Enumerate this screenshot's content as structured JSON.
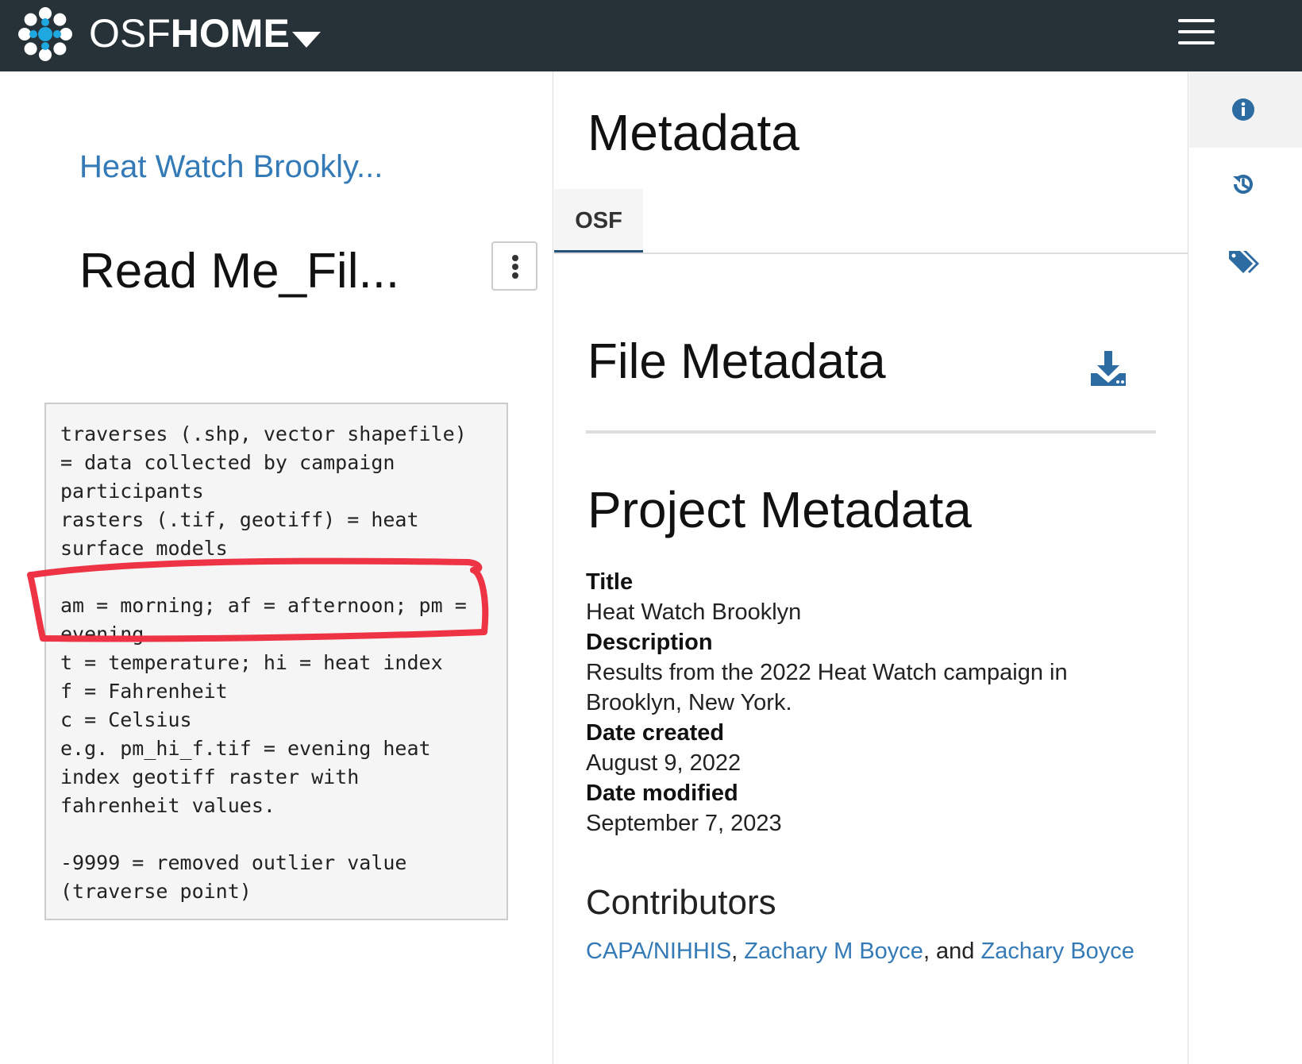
{
  "header": {
    "brand_osf": "OSF",
    "brand_home": "HOME",
    "icons": {
      "logo": "osf-logo-icon",
      "caret": "caret-down-icon",
      "menu": "hamburger-menu-icon"
    },
    "colors": {
      "bar": "#263238",
      "text": "#ffffff"
    }
  },
  "left": {
    "breadcrumb": "Heat Watch Brookly...",
    "file_title": "Read Me_Fil...",
    "kebab_icon": "vertical-ellipsis-icon",
    "readme_text": "traverses (.shp, vector shapefile)\n= data collected by campaign\nparticipants\nrasters (.tif, geotiff) = heat\nsurface models\n\nam = morning; af = afternoon; pm =\nevening\nt = temperature; hi = heat index\nf = Fahrenheit\nc = Celsius\ne.g. pm_hi_f.tif = evening heat\nindex geotiff raster with\nfahrenheit values.\n\n-9999 = removed outlier value\n(traverse point)",
    "annotation_color": "#ee3344"
  },
  "metadata": {
    "heading": "Metadata",
    "tab_osf": "OSF",
    "file_metadata_heading": "File Metadata",
    "download_icon": "download-icon",
    "project_metadata_heading": "Project Metadata",
    "fields": {
      "title_label": "Title",
      "title_value": "Heat Watch Brooklyn",
      "description_label": "Description",
      "description_value": "Results from the 2022 Heat Watch campaign in Brooklyn, New York.",
      "date_created_label": "Date created",
      "date_created_value": "August 9, 2022",
      "date_modified_label": "Date modified",
      "date_modified_value": "September 7, 2023"
    },
    "contributors_heading": "Contributors",
    "contributors": [
      "CAPA/NIHHIS",
      "Zachary M Boyce",
      "Zachary Boyce"
    ],
    "contributors_sep1": ", ",
    "contributors_sep2": ", and ",
    "link_color": "#337ab7"
  },
  "rail": {
    "icons": [
      "info-icon",
      "history-icon",
      "tags-icon"
    ],
    "icon_color": "#2d6ca2"
  }
}
